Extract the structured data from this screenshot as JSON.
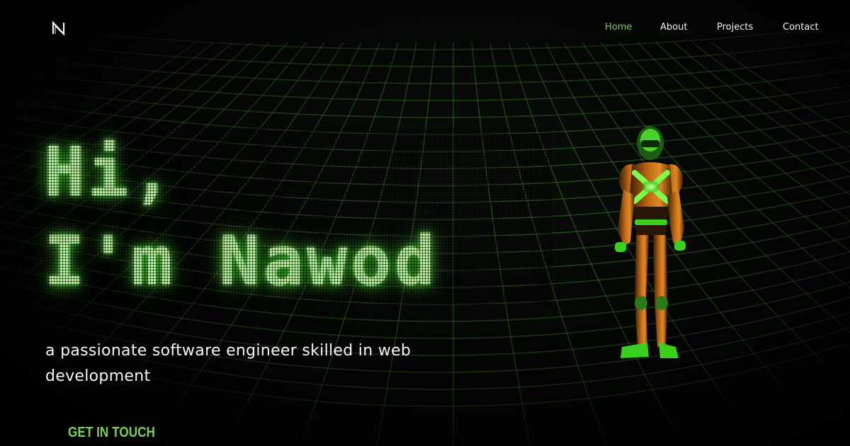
{
  "brand": {
    "logo_icon": "N-monogram-logo"
  },
  "nav": {
    "items": [
      {
        "label": "Home",
        "active": true
      },
      {
        "label": "About",
        "active": false
      },
      {
        "label": "Projects",
        "active": false
      },
      {
        "label": "Contact",
        "active": false
      }
    ]
  },
  "hero": {
    "title_line1": "Hi,",
    "title_line2": "I'm Nawod",
    "subtitle": "a passionate software engineer skilled in web development",
    "cta_label": "GET IN TOUCH",
    "character_image": "armored-robot-figure"
  },
  "colors": {
    "accent_green": "#7bc95a",
    "title_glow": "#6ee84a",
    "background": "#000000",
    "text": "#f5f5f5"
  }
}
